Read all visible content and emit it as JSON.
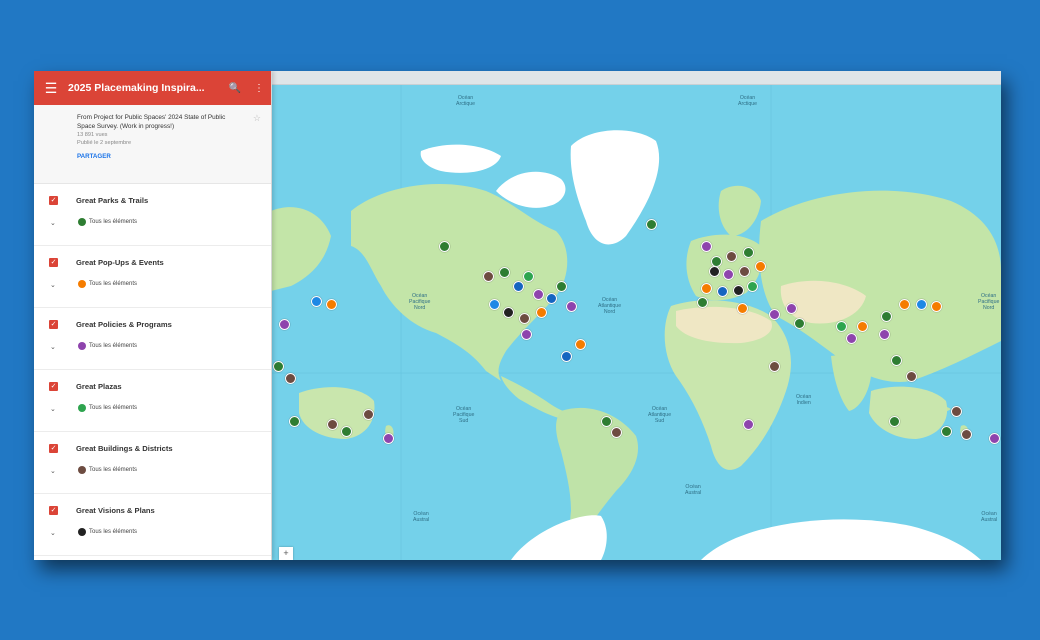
{
  "header": {
    "title": "2025 Placemaking Inspira...",
    "menu_icon": "hamburger-menu-icon",
    "search_icon": "search-icon",
    "more_icon": "more-vertical-icon"
  },
  "info": {
    "description": "From Project for Public Spaces' 2024 State of Public Space Survey. (Work in progress!)",
    "views": "13 891 vues",
    "published": "Publié le 2 septembre",
    "share_label": "PARTAGER"
  },
  "layers": [
    {
      "name": "Great Parks & Trails",
      "all_label": "Tous les éléments",
      "color": "#2e7d32"
    },
    {
      "name": "Great Pop-Ups & Events",
      "all_label": "Tous les éléments",
      "color": "#f57c00"
    },
    {
      "name": "Great Policies & Programs",
      "all_label": "Tous les éléments",
      "color": "#8e44ad"
    },
    {
      "name": "Great Plazas",
      "all_label": "Tous les éléments",
      "color": "#2ea44f"
    },
    {
      "name": "Great Buildings & Districts",
      "all_label": "Tous les éléments",
      "color": "#6d4c41"
    },
    {
      "name": "Great Visions & Plans",
      "all_label": "Tous les éléments",
      "color": "#222222"
    }
  ],
  "map": {
    "ocean_labels": [
      {
        "text": "Océan\nArctique"
      },
      {
        "text": "Océan\nArctique"
      },
      {
        "text": "Océan\nPacifique\nNord"
      },
      {
        "text": "Océan\nAtlantique\nNord"
      },
      {
        "text": "Océan\nPacifique\nNord"
      },
      {
        "text": "Océan\nPacifique\nSud"
      },
      {
        "text": "Océan\nAtlantique\nSud"
      },
      {
        "text": "Océan\nIndien"
      },
      {
        "text": "Océan\nAustral"
      },
      {
        "text": "Océan\nAustral"
      },
      {
        "text": "Océan\nAustral"
      }
    ],
    "zoom_in_label": "+"
  },
  "colors": {
    "brand_red": "#db4437",
    "ocean": "#74d1ea",
    "land": "#bfe3a8",
    "ice": "#ffffff",
    "desert": "#f1e9c8",
    "background": "#2178c4"
  }
}
